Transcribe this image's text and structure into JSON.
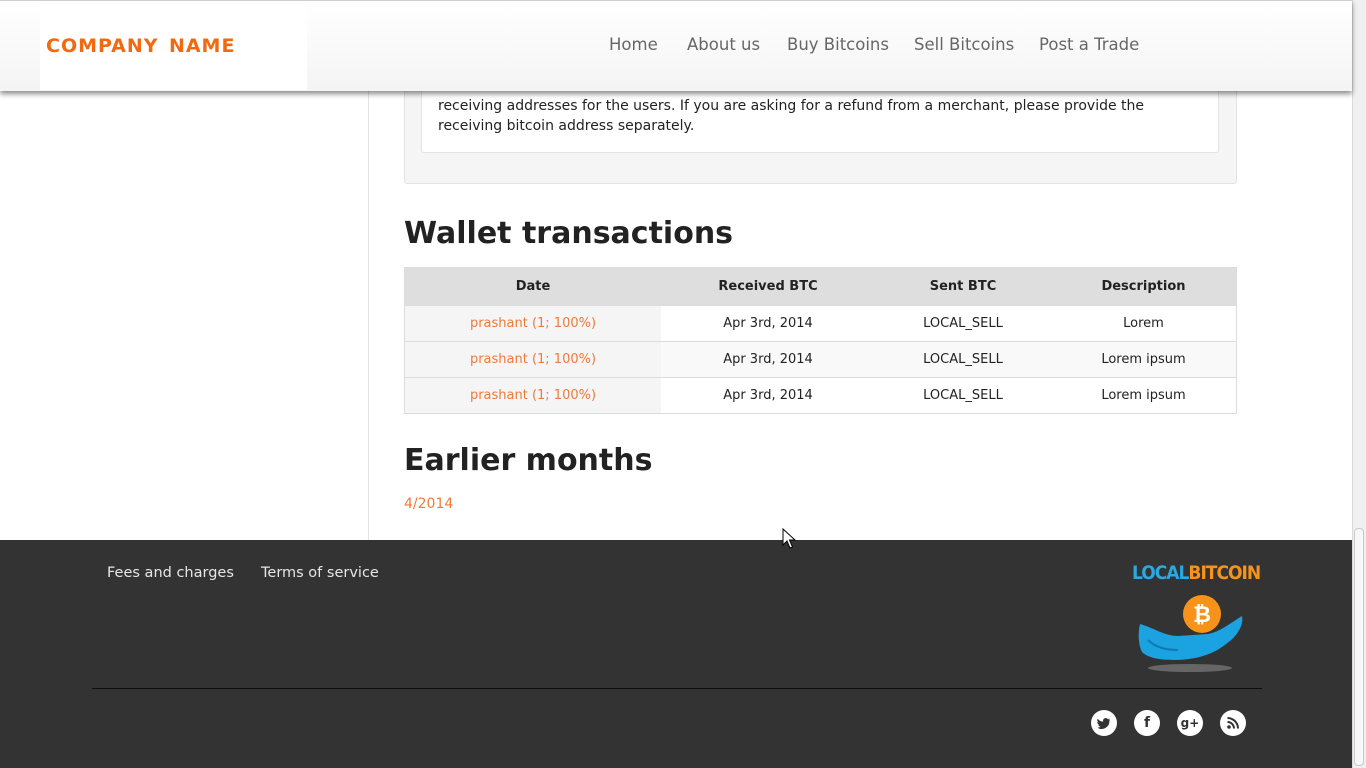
{
  "header": {
    "logo": "company name",
    "nav": [
      "Home",
      "About us",
      "Buy Bitcoins",
      "Sell Bitcoins",
      "Post a Trade"
    ]
  },
  "notice": {
    "text": "receiving addresses for the users. If you are asking for a refund from a merchant, please provide the receiving bitcoin address separately."
  },
  "wallet": {
    "title": "Wallet transactions",
    "columns": [
      "Date",
      "Received BTC",
      "Sent BTC",
      "Description"
    ],
    "rows": [
      [
        "prashant (1; 100%)",
        "Apr 3rd, 2014",
        "LOCAL_SELL",
        "Lorem"
      ],
      [
        "prashant (1; 100%)",
        "Apr 3rd, 2014",
        "LOCAL_SELL",
        "Lorem ipsum"
      ],
      [
        "prashant (1; 100%)",
        "Apr 3rd, 2014",
        "LOCAL_SELL",
        "Lorem ipsum"
      ]
    ]
  },
  "earlier": {
    "title": "Earlier months",
    "months": [
      "4/2014"
    ]
  },
  "footer": {
    "links": [
      "Fees and charges",
      "Terms of service"
    ],
    "brand_part1": "LOCAL",
    "brand_part2": "BITCOIN",
    "social": [
      "twitter-icon",
      "facebook-icon",
      "google-plus-icon",
      "rss-icon"
    ]
  },
  "colors": {
    "accent": "#f26a0f",
    "link": "#f07a3a",
    "footer_bg": "#333333",
    "brand_blue": "#29a9e1",
    "brand_orange": "#f7931a"
  }
}
